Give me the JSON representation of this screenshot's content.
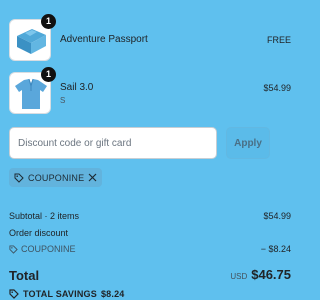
{
  "items": [
    {
      "name": "Adventure Passport",
      "variant": "",
      "price": "FREE",
      "quantity": "1",
      "thumbnail": "folded-blue-shirt"
    },
    {
      "name": "Sail 3.0",
      "variant": "S",
      "price": "$54.99",
      "quantity": "1",
      "thumbnail": "blue-polo-shirt"
    }
  ],
  "discount": {
    "placeholder": "Discount code or gift card",
    "value": "",
    "apply_label": "Apply",
    "applied_code": "COUPONINE",
    "tag_icon": "tag-icon",
    "remove_icon": "close-icon"
  },
  "summary": {
    "subtotal_label": "Subtotal · 2 items",
    "subtotal_value": "$54.99",
    "order_discount_label": "Order discount",
    "discount_code": "COUPONINE",
    "discount_value": "− $8.24",
    "total_label": "Total",
    "currency": "USD",
    "total_value": "$46.75",
    "savings_label": "TOTAL SAVINGS",
    "savings_value": "$8.24"
  },
  "colors": {
    "background": "#5fc0ee",
    "text": "#202428",
    "chip": "#62b3dd",
    "badge": "#111111"
  }
}
